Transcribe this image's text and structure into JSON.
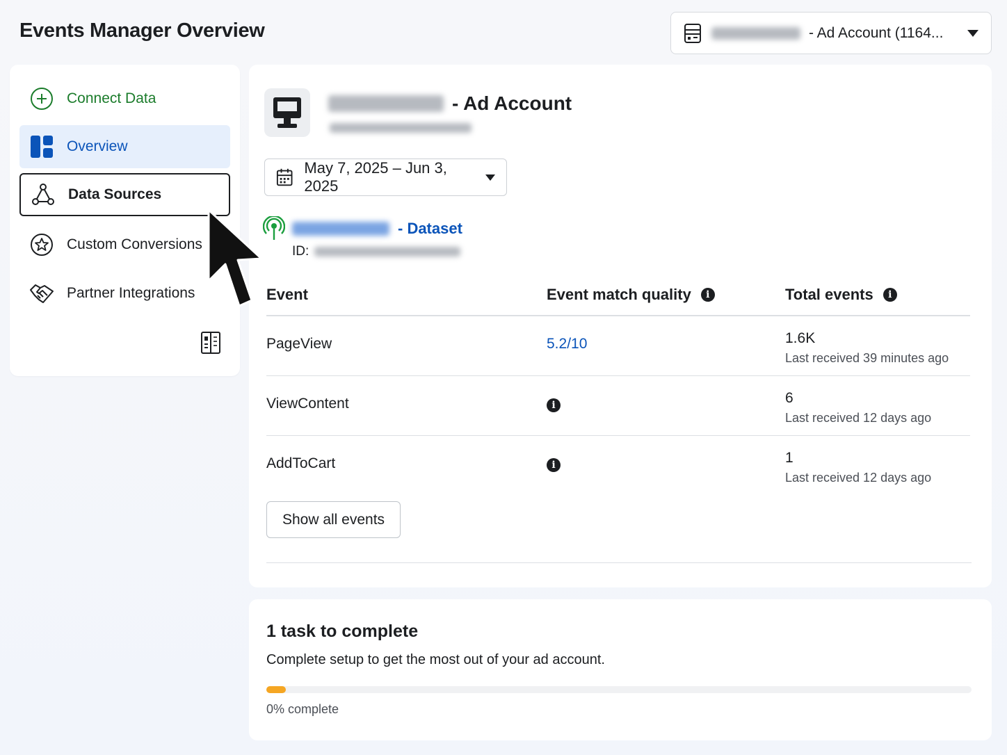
{
  "header": {
    "title": "Events Manager Overview",
    "account_selector_label": "- Ad Account (1164...",
    "account_icon": "building-icon"
  },
  "sidebar": {
    "items": [
      {
        "label": "Connect Data",
        "icon": "plus-circle-icon"
      },
      {
        "label": "Overview",
        "icon": "dashboard-icon"
      },
      {
        "label": "Data Sources",
        "icon": "network-icon"
      },
      {
        "label": "Custom Conversions",
        "icon": "star-badge-icon"
      },
      {
        "label": "Partner Integrations",
        "icon": "handshake-icon"
      }
    ],
    "toggle_icon": "panel-toggle-icon"
  },
  "account": {
    "name_suffix": "- Ad Account",
    "avatar_icon": "computer-icon"
  },
  "date_range": {
    "label": "May 7, 2025 – Jun 3, 2025",
    "icon": "calendar-icon"
  },
  "dataset": {
    "label": "- Dataset",
    "id_label": "ID:",
    "icon": "broadcast-icon"
  },
  "events_table": {
    "headers": {
      "event": "Event",
      "quality": "Event match quality",
      "total": "Total events"
    },
    "rows": [
      {
        "event": "PageView",
        "quality": "5.2/10",
        "total": "1.6K",
        "last_received": "Last received 39 minutes ago"
      },
      {
        "event": "ViewContent",
        "quality": "",
        "total": "6",
        "last_received": "Last received 12 days ago"
      },
      {
        "event": "AddToCart",
        "quality": "",
        "total": "1",
        "last_received": "Last received 12 days ago"
      }
    ],
    "show_all_label": "Show all events"
  },
  "tasks": {
    "title": "1 task to complete",
    "description": "Complete setup to get the most out of your ad account.",
    "progress_percent": 0,
    "progress_label": "0% complete"
  },
  "colors": {
    "accent_blue": "#0b54b9",
    "connect_green": "#1b7c2b",
    "progress_orange": "#f5a623",
    "selected_bg": "#e6effc"
  }
}
